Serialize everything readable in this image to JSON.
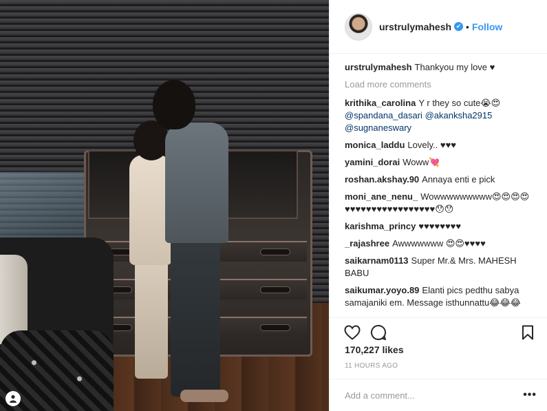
{
  "post": {
    "username": "urstrulymahesh",
    "dot": "•",
    "follow_label": "Follow",
    "verified_icon": "✔"
  },
  "caption": {
    "username": "urstrulymahesh",
    "text": "Thankyou my love ♥"
  },
  "load_more": "Load more comments",
  "comments": [
    {
      "user": "krithika_carolina",
      "text": "Y r they so cute😭😍",
      "mentions": [
        "@spandana_dasari",
        "@akanksha2915",
        "@sugnaneswary"
      ]
    },
    {
      "user": "monica_laddu",
      "text": "Lovely.. ♥♥♥"
    },
    {
      "user": "yamini_dorai",
      "text": "Woww💘"
    },
    {
      "user": "roshan.akshay.90",
      "text": "Annaya enti e pick"
    },
    {
      "user": "moni_ane_nenu_",
      "text": "Wowwwwwwwww😍😍😍😍♥♥♥♥♥♥♥♥♥♥♥♥♥♥♥♥♥😯😯"
    },
    {
      "user": "karishma_princy",
      "text": "♥♥♥♥♥♥♥♥"
    },
    {
      "user": "_rajashree",
      "text": "Awwwwwww 😍😍♥♥♥♥"
    },
    {
      "user": "saikarnam0113",
      "text": "Super Mr.& Mrs. MAHESH BABU"
    },
    {
      "user": "saikumar.yoyo.89",
      "text": "Elanti pics pedthu sabya samajaniki em. Message isthunnattu😂😂😂"
    }
  ],
  "likes": "170,227 likes",
  "time": "11 HOURS AGO",
  "add_comment_placeholder": "Add a comment...",
  "more_dots": "•••",
  "colors": {
    "accent": "#3897f0",
    "text": "#262626",
    "muted": "#999999"
  }
}
